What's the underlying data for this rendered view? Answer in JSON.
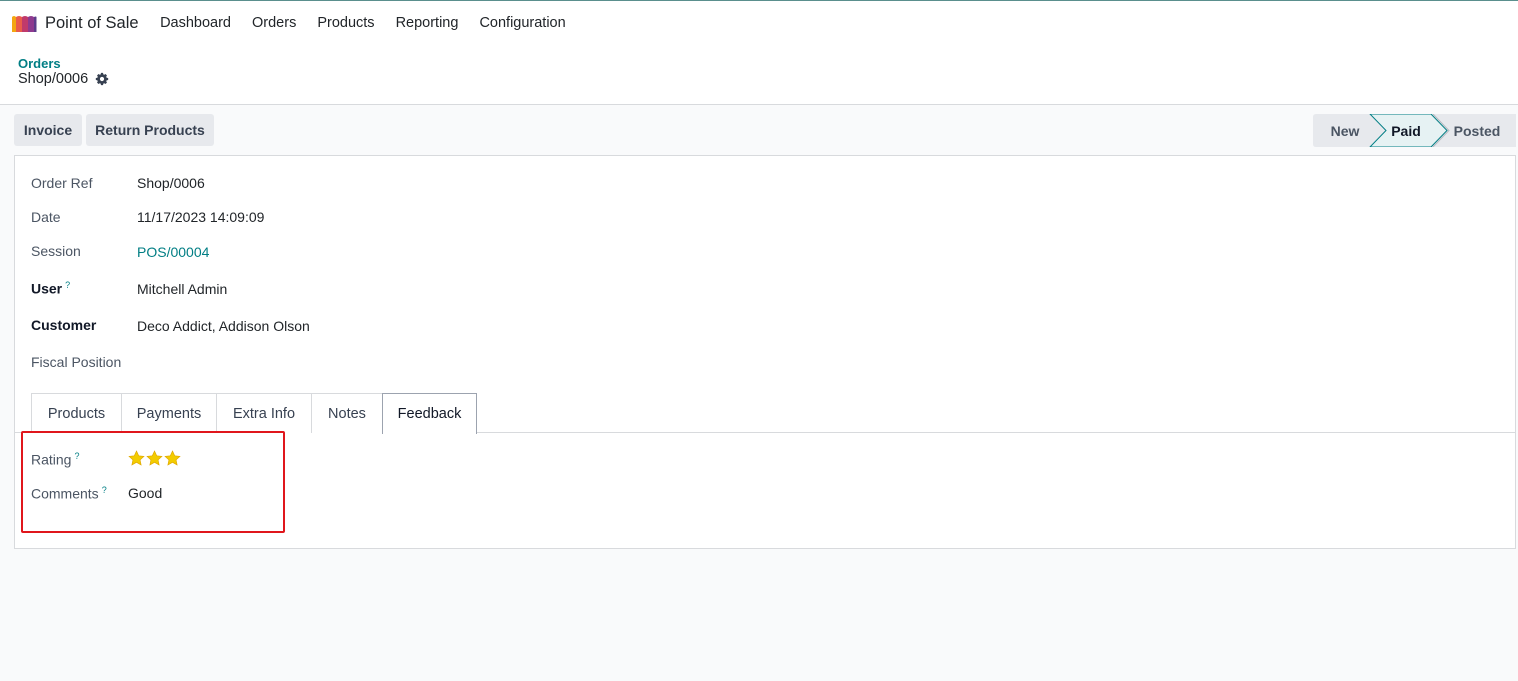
{
  "app": {
    "title": "Point of Sale",
    "logo_icon": "pos-shop-icon",
    "menu": [
      "Dashboard",
      "Orders",
      "Products",
      "Reporting",
      "Configuration"
    ]
  },
  "breadcrumb": {
    "parent": "Orders",
    "current": "Shop/0006",
    "gear_icon": "gear-icon"
  },
  "actions": {
    "invoice": "Invoice",
    "return_products": "Return Products"
  },
  "status": {
    "stages": [
      "New",
      "Paid",
      "Posted"
    ],
    "current": "Paid"
  },
  "form": {
    "order_ref": {
      "label": "Order Ref",
      "value": "Shop/0006"
    },
    "date": {
      "label": "Date",
      "value": "11/17/2023 14:09:09"
    },
    "session": {
      "label": "Session",
      "value": "POS/00004"
    },
    "user": {
      "label": "User",
      "help": "?",
      "value": "Mitchell Admin"
    },
    "customer": {
      "label": "Customer",
      "value": "Deco Addict, Addison Olson"
    },
    "fiscal_position": {
      "label": "Fiscal Position",
      "value": ""
    }
  },
  "tabs": [
    "Products",
    "Payments",
    "Extra Info",
    "Notes",
    "Feedback"
  ],
  "active_tab": "Feedback",
  "feedback": {
    "rating": {
      "label": "Rating",
      "help": "?",
      "stars": 3,
      "max_stars": 3
    },
    "comments": {
      "label": "Comments",
      "help": "?",
      "value": "Good"
    }
  },
  "colors": {
    "accent": "#017e84",
    "highlight_box": "#e0161c",
    "star": "#f3cc00",
    "paid_stage_bg": "#e6f2f3"
  }
}
